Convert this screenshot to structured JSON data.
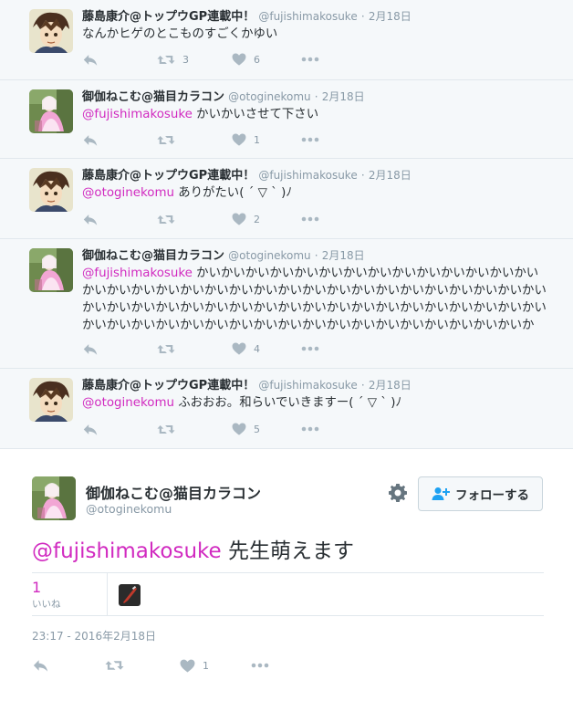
{
  "tweets": [
    {
      "name": "藤島康介@トップウGP連載中！",
      "handle": "@fujishimakosuke",
      "time": "2月18日",
      "mention": "",
      "text": "なんかヒゲのとこものすごくかゆい",
      "retweets": "3",
      "likes": "6"
    },
    {
      "name": "御伽ねこむ@猫目カラコン",
      "handle": "@otoginekomu",
      "time": "2月18日",
      "mention": "@fujishimakosuke",
      "text": " かいかいさせて下さい",
      "retweets": "",
      "likes": "1"
    },
    {
      "name": "藤島康介@トップウGP連載中！",
      "handle": "@fujishimakosuke",
      "time": "2月18日",
      "mention": "@otoginekomu",
      "text": " ありがたい( ´ ▽ ` )ﾉ",
      "retweets": "",
      "likes": "2"
    },
    {
      "name": "御伽ねこむ@猫目カラコン",
      "handle": "@otoginekomu",
      "time": "2月18日",
      "mention": "@fujishimakosuke",
      "text": " かいかいかいかいかいかいかいかいかいかいかいかいかいかいかいかいかいかいかいかいかいかいかいかいかいかいかいかいかいかいかいかいかいかいかいかいかいかいかいかいかいかいかいかいかいかいかいかいかいかいかいかいかいかいかいかいかいかいかいかいかいかいかいかいかいかいかいかいかいかいか",
      "retweets": "",
      "likes": "4"
    },
    {
      "name": "藤島康介@トップウGP連載中！",
      "handle": "@fujishimakosuke",
      "time": "2月18日",
      "mention": "@otoginekomu",
      "text": " ふおおお。和らいでいきますー( ´ ▽ ` )ﾉ",
      "retweets": "",
      "likes": "5"
    }
  ],
  "main": {
    "name": "御伽ねこむ@猫目カラコン",
    "handle": "@otoginekomu",
    "mention": "@fujishimakosuke",
    "text": " 先生萌えます",
    "follow_label": "フォローする",
    "likes_count": "1",
    "likes_label": "いいね",
    "timestamp": "23:17 - 2016年2月18日",
    "action_likes": "1"
  },
  "separator": "·",
  "icons": {
    "reply": "reply-icon",
    "retweet": "retweet-icon",
    "like": "heart-icon",
    "more": "more-icon",
    "settings": "gear-icon",
    "follow": "add-user-icon"
  },
  "colors": {
    "mention": "#d12ac0",
    "action": "#aab8c2",
    "background": "#f5f8fa",
    "border": "#e1e8ed"
  }
}
